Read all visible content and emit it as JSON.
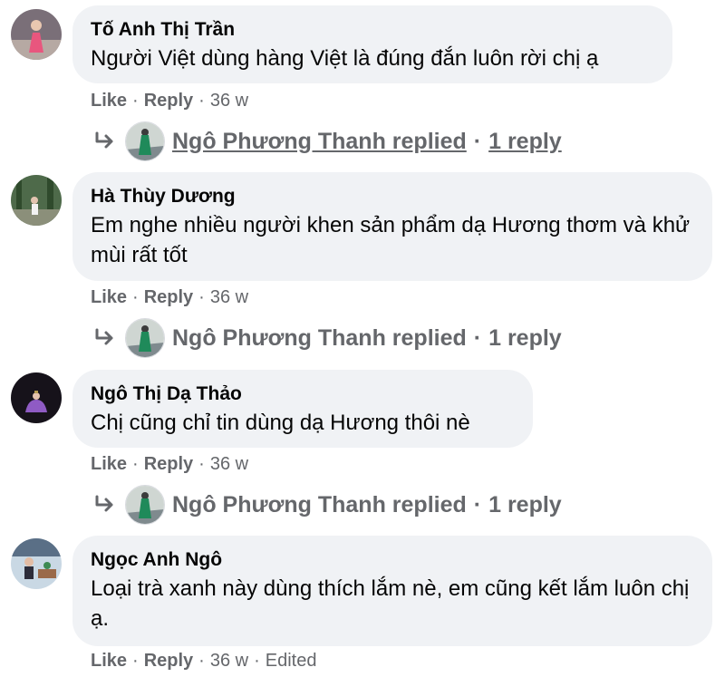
{
  "comments": [
    {
      "author": "Tố Anh Thị Trần",
      "text": "Người Việt dùng hàng Việt là đúng đắn luôn rời chị ạ",
      "like": "Like",
      "reply": "Reply",
      "time": "36 w",
      "edited": "",
      "thread": {
        "replier": "Ngô Phương Thanh replied",
        "count": "1 reply"
      }
    },
    {
      "author": "Hà Thùy Dương",
      "text": "Em nghe nhiều người khen sản phẩm dạ Hương thơm và khử mùi rất tốt",
      "like": "Like",
      "reply": "Reply",
      "time": "36 w",
      "edited": "",
      "thread": {
        "replier": "Ngô Phương Thanh replied",
        "count": "1 reply"
      }
    },
    {
      "author": "Ngô Thị Dạ Thảo",
      "text": "Chị cũng chỉ tin dùng dạ Hương thôi nè",
      "like": "Like",
      "reply": "Reply",
      "time": "36 w",
      "edited": "",
      "thread": {
        "replier": "Ngô Phương Thanh replied",
        "count": "1 reply"
      }
    },
    {
      "author": "Ngọc Anh Ngô",
      "text": "Loại trà xanh này dùng thích lắm nè, em cũng kết lắm luôn chị ạ.",
      "like": "Like",
      "reply": "Reply",
      "time": "36 w",
      "edited": "Edited",
      "thread": null
    }
  ],
  "icons": {
    "reply_arrow": "reply-arrow-icon"
  },
  "colors": {
    "bubble": "#f0f2f5",
    "meta": "#65676b",
    "text": "#050505"
  }
}
